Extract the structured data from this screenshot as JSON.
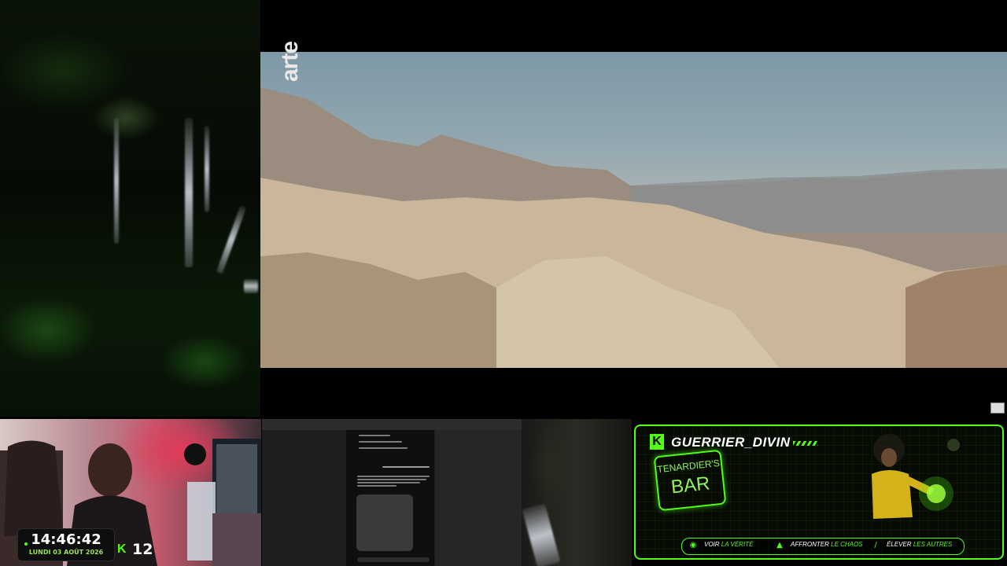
{
  "player": {
    "channel_logo_text": "arte"
  },
  "clock": {
    "time": "14:46:42",
    "date": "LUNDI 03 AOÛT 2026"
  },
  "viewers": {
    "platform_letter": "K",
    "count": "12"
  },
  "banner": {
    "platform_letter": "K",
    "streamer_name": "GUERRIER_DIVIN",
    "sign_line1": "TENARDIER'S",
    "sign_line2": "BAR",
    "cta": [
      {
        "icon": "eye-icon",
        "prefix": "VOIR",
        "highlight": "LA VÉRITÉ"
      },
      {
        "icon": "flame-icon",
        "prefix": "AFFRONTER",
        "highlight": "LE CHAOS"
      },
      {
        "icon": "feather-icon",
        "prefix": "ÉLEVER",
        "highlight": "LES AUTRES"
      }
    ]
  },
  "colors": {
    "accent": "#53fc18",
    "background": "#000000"
  }
}
